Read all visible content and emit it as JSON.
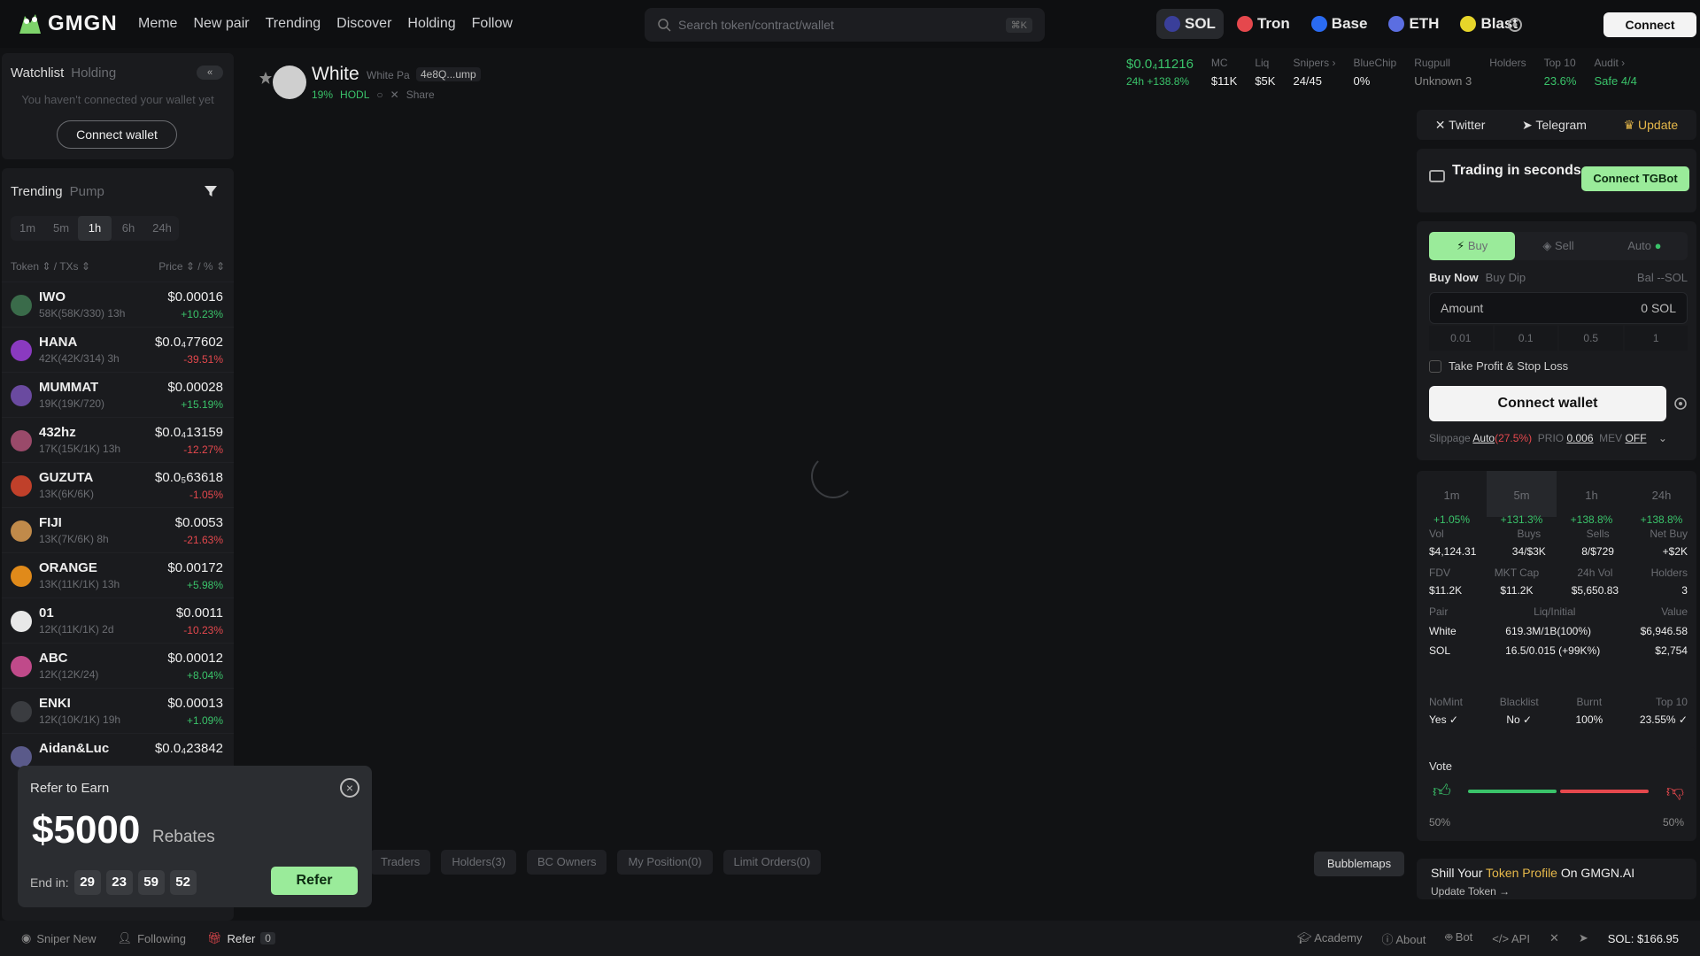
{
  "brand": {
    "name": "GMGN"
  },
  "nav": [
    "Meme",
    "New pair",
    "Trending",
    "Discover",
    "Holding",
    "Follow"
  ],
  "search": {
    "placeholder": "Search token/contract/wallet",
    "shortcut": "⌘K"
  },
  "chains": [
    {
      "label": "SOL",
      "color": "#3a3f9a",
      "active": true
    },
    {
      "label": "Tron",
      "color": "#e5484d"
    },
    {
      "label": "Base",
      "color": "#2a6bf2"
    },
    {
      "label": "ETH",
      "color": "#5b6ee1"
    },
    {
      "label": "Blast",
      "color": "#e6d52a"
    }
  ],
  "top_connect": "Connect",
  "watchlist": {
    "tab_active": "Watchlist",
    "tab_other": "Holding",
    "collapse": "«",
    "message": "You haven't connected your wallet yet",
    "button": "Connect wallet"
  },
  "trending": {
    "tab_active": "Trending",
    "tab_other": "Pump",
    "timeframes": [
      "1m",
      "5m",
      "1h",
      "6h",
      "24h"
    ],
    "active_timeframe": "1h",
    "col_token": "Token ⇕ / TXs ⇕",
    "col_price": "Price ⇕ / % ⇕",
    "rows": [
      {
        "name": "IWO",
        "sub": "58K(58K/330) 13h",
        "price": "$0.00016",
        "change": "+10.23%",
        "dir": "up",
        "color": "#3a6b4a"
      },
      {
        "name": "HANA",
        "sub": "42K(42K/314) 3h",
        "price": "$0.0₄77602",
        "change": "-39.51%",
        "dir": "dn",
        "color": "#8a3ac0"
      },
      {
        "name": "MUMMAT",
        "sub": "19K(19K/720)",
        "price": "$0.00028",
        "change": "+15.19%",
        "dir": "up",
        "color": "#6a4aa0"
      },
      {
        "name": "432hz",
        "sub": "17K(15K/1K) 13h",
        "price": "$0.0₄13159",
        "change": "-12.27%",
        "dir": "dn",
        "color": "#9a4a6a"
      },
      {
        "name": "GUZUTA",
        "sub": "13K(6K/6K)",
        "price": "$0.0₅63618",
        "change": "-1.05%",
        "dir": "dn",
        "color": "#c0402a"
      },
      {
        "name": "FIJI",
        "sub": "13K(7K/6K) 8h",
        "price": "$0.0053",
        "change": "-21.63%",
        "dir": "dn",
        "color": "#c08a4a"
      },
      {
        "name": "ORANGE",
        "sub": "13K(11K/1K) 13h",
        "price": "$0.00172",
        "change": "+5.98%",
        "dir": "up",
        "color": "#e08a1a"
      },
      {
        "name": "01",
        "sub": "12K(11K/1K) 2d",
        "price": "$0.0011",
        "change": "-10.23%",
        "dir": "dn",
        "color": "#e8e8e8"
      },
      {
        "name": "ABC",
        "sub": "12K(12K/24)",
        "price": "$0.00012",
        "change": "+8.04%",
        "dir": "up",
        "color": "#c04a8a"
      },
      {
        "name": "ENKI",
        "sub": "12K(10K/1K) 19h",
        "price": "$0.00013",
        "change": "+1.09%",
        "dir": "up",
        "color": "#3a3c40"
      },
      {
        "name": "Aidan&Luc",
        "sub": "",
        "price": "$0.0₄23842",
        "change": "",
        "dir": "up",
        "color": "#5a5a8a"
      }
    ]
  },
  "refer": {
    "title": "Refer to Earn",
    "amount": "$5000",
    "rebates": "Rebates",
    "end_label": "End in:",
    "timer": [
      "29",
      "23",
      "59",
      "52"
    ],
    "button": "Refer"
  },
  "token": {
    "name": "White",
    "full_name": "White Pa",
    "contract": "4e8Q...ump",
    "percent": "19%",
    "hodl": "HODL",
    "share": "Share"
  },
  "stats": [
    {
      "k": "$0.0₄11216",
      "v": "24h +138.8%"
    },
    {
      "k": "MC",
      "v": "$11K"
    },
    {
      "k": "Liq",
      "v": "$5K"
    },
    {
      "k": "Snipers ›",
      "v": "24/45"
    },
    {
      "k": "BlueChip",
      "v": "0%"
    },
    {
      "k": "Rugpull",
      "v": "Unknown 3"
    },
    {
      "k": "Holders",
      "v": ""
    },
    {
      "k": "Top 10",
      "v": "23.6%"
    },
    {
      "k": "Audit ›",
      "v": "Safe 4/4"
    }
  ],
  "bottom_tabs": [
    "Traders",
    "Holders(3)",
    "BC Owners",
    "My Position(0)",
    "Limit Orders(0)"
  ],
  "bubblemaps": "Bubblemaps",
  "socials": {
    "twitter": "Twitter",
    "telegram": "Telegram",
    "update": "Update"
  },
  "tgbot": {
    "title": "Trading in seconds",
    "button": "Connect TGBot"
  },
  "trade": {
    "buy": "Buy",
    "sell": "Sell",
    "auto": "Auto",
    "buy_now": "Buy Now",
    "buy_dip": "Buy Dip",
    "balance": "Bal --SOL",
    "amount_label": "Amount",
    "amount_value": "0 SOL",
    "quick": [
      "0.01",
      "0.1",
      "0.5",
      "1"
    ],
    "tpsl": "Take Profit & Stop Loss",
    "connect": "Connect wallet",
    "slippage": "Slippage",
    "slippage_val": "Auto",
    "slippage_pct": "(27.5%)",
    "prio": "PRIO",
    "prio_val": "0.006",
    "mev": "MEV",
    "mev_val": "OFF"
  },
  "periods": [
    {
      "k": "1m",
      "v": "+1.05%"
    },
    {
      "k": "5m",
      "v": "+131.3%",
      "on": true
    },
    {
      "k": "1h",
      "v": "+138.8%"
    },
    {
      "k": "24h",
      "v": "+138.8%"
    }
  ],
  "metrics1": [
    {
      "k": "Vol",
      "v": "$4,124.31"
    },
    {
      "k": "Buys",
      "v": "34/$3K"
    },
    {
      "k": "Sells",
      "v": "8/$729"
    },
    {
      "k": "Net Buy",
      "v": "+$2K"
    }
  ],
  "metrics2": [
    {
      "k": "FDV",
      "v": "$11.2K"
    },
    {
      "k": "MKT Cap",
      "v": "$11.2K"
    },
    {
      "k": "24h Vol",
      "v": "$5,650.83"
    },
    {
      "k": "Holders",
      "v": "3"
    }
  ],
  "pair": {
    "headers": [
      "Pair",
      "Liq/Initial",
      "Value"
    ],
    "rows": [
      [
        "White",
        "619.3M/1B(100%)",
        "$6,946.58"
      ],
      [
        "SOL",
        "16.5/0.015 (+99K%)",
        "$2,754"
      ]
    ]
  },
  "security": [
    {
      "k": "NoMint",
      "v": "Yes ✓"
    },
    {
      "k": "Blacklist",
      "v": "No ✓"
    },
    {
      "k": "Burnt",
      "v": "100%"
    },
    {
      "k": "Top 10",
      "v": "23.55% ✓"
    }
  ],
  "vote": {
    "title": "Vote",
    "up": "50%",
    "down": "50%",
    "up_fraction": 0.5
  },
  "shill": {
    "prefix": "Shill Your",
    "highlight": "Token Profile",
    "suffix": "On GMGN.AI",
    "link": "Update Token →"
  },
  "footer": {
    "sniper": "Sniper New",
    "following": "Following",
    "refer": "Refer",
    "refer_count": "0",
    "academy": "Academy",
    "about": "About",
    "bot": "Bot",
    "api": "</> API",
    "sol": "SOL: $166.95"
  }
}
